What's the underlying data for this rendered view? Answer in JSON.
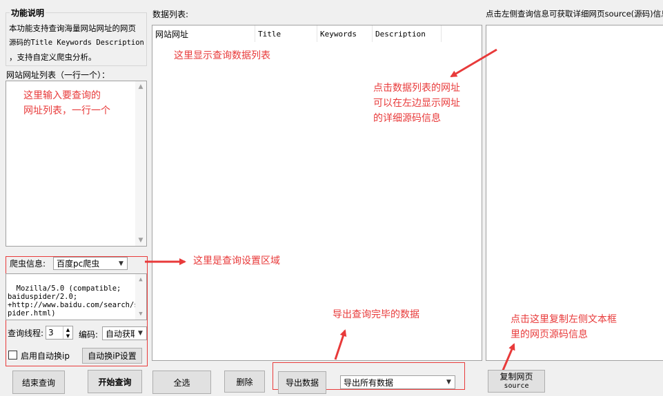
{
  "func_desc": {
    "title": "功能说明",
    "line1": "本功能支持查询海量网站网址的网页",
    "line2": "源码的Title Keywords Description",
    "line3": "，支持自定义爬虫分析。"
  },
  "url_list": {
    "label": "网站网址列表（一行一个）：",
    "hint_line1": "这里输入要查询的",
    "hint_line2": "网址列表，一行一个"
  },
  "spider": {
    "label": "爬虫信息:",
    "selected": "百度pc爬虫",
    "ua_text": "Mozilla/5.0 (compatible;\nbaiduspider/2.0;\n+http://www.baidu.com/search/s\npider.html)",
    "threads_label": "查询线程:",
    "threads_value": "3",
    "encoding_label": "编码:",
    "encoding_selected": "自动获取",
    "auto_ip_label": "启用自动换ip",
    "auto_ip_button": "自动换iP设置"
  },
  "data_list": {
    "label": "数据列表:",
    "columns": [
      "网站网址",
      "Title",
      "Keywords",
      "Description"
    ],
    "hint": "这里显示查询数据列表"
  },
  "source_panel": {
    "label": "点击左侧查询信息可获取详细网页source(源码)信息"
  },
  "annotations": {
    "click_line1": "点击数据列表的网址",
    "click_line2": "可以在左边显示网址",
    "click_line3": "的详细源码信息",
    "settings": "这里是查询设置区域",
    "export": "导出查询完毕的数据",
    "copy_line1": "点击这里复制左侧文本框",
    "copy_line2": "里的网页源码信息"
  },
  "buttons": {
    "stop": "结束查询",
    "start": "开始查询",
    "select_all": "全选",
    "delete": "删除",
    "export": "导出数据",
    "export_mode": "导出所有数据",
    "copy_line1": "复制网页",
    "copy_line2": "source"
  },
  "colors": {
    "annotation": "#e83a3a",
    "background": "#f0f0f0"
  }
}
